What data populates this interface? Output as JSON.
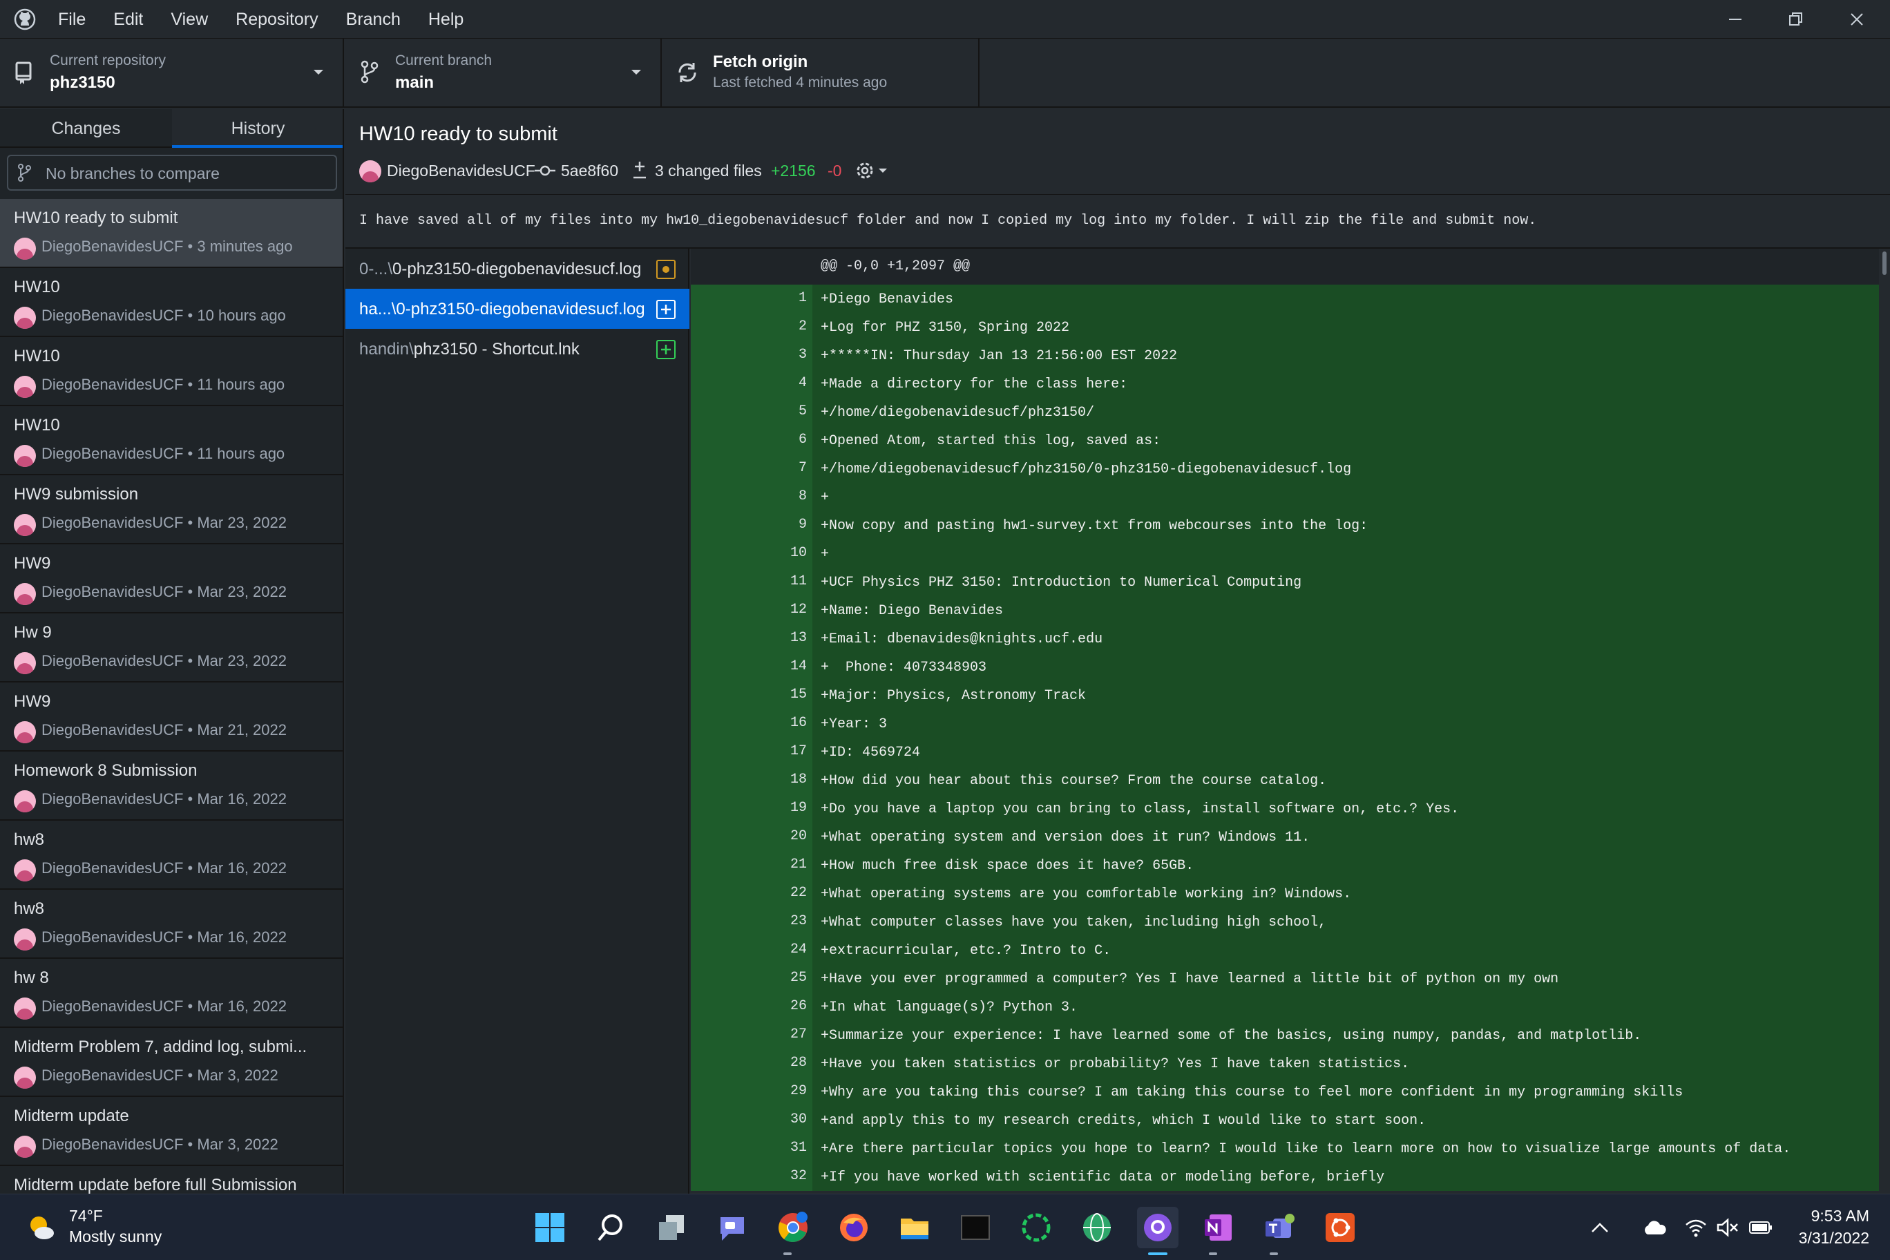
{
  "menu": [
    "File",
    "Edit",
    "View",
    "Repository",
    "Branch",
    "Help"
  ],
  "toolbar": {
    "repo_label": "Current repository",
    "repo_value": "phz3150",
    "branch_label": "Current branch",
    "branch_value": "main",
    "fetch_label": "Fetch origin",
    "fetch_sub": "Last fetched 4 minutes ago"
  },
  "tabs": {
    "changes": "Changes",
    "history": "History"
  },
  "compare_placeholder": "No branches to compare",
  "commits": [
    {
      "title": "HW10 ready to submit",
      "meta": "DiegoBenavidesUCF • 3 minutes ago"
    },
    {
      "title": "HW10",
      "meta": "DiegoBenavidesUCF • 10 hours ago"
    },
    {
      "title": "HW10",
      "meta": "DiegoBenavidesUCF • 11 hours ago"
    },
    {
      "title": "HW10",
      "meta": "DiegoBenavidesUCF • 11 hours ago"
    },
    {
      "title": "HW9 submission",
      "meta": "DiegoBenavidesUCF • Mar 23, 2022"
    },
    {
      "title": "HW9",
      "meta": "DiegoBenavidesUCF • Mar 23, 2022"
    },
    {
      "title": "Hw 9",
      "meta": "DiegoBenavidesUCF • Mar 23, 2022"
    },
    {
      "title": "HW9",
      "meta": "DiegoBenavidesUCF • Mar 21, 2022"
    },
    {
      "title": "Homework 8 Submission",
      "meta": "DiegoBenavidesUCF • Mar 16, 2022"
    },
    {
      "title": "hw8",
      "meta": "DiegoBenavidesUCF • Mar 16, 2022"
    },
    {
      "title": "hw8",
      "meta": "DiegoBenavidesUCF • Mar 16, 2022"
    },
    {
      "title": "hw 8",
      "meta": "DiegoBenavidesUCF • Mar 16, 2022"
    },
    {
      "title": "Midterm Problem 7, addind log, submi...",
      "meta": "DiegoBenavidesUCF • Mar 3, 2022"
    },
    {
      "title": "Midterm update",
      "meta": "DiegoBenavidesUCF • Mar 3, 2022"
    },
    {
      "title": "Midterm update before full Submission",
      "meta": ""
    }
  ],
  "commit_detail": {
    "title": "HW10 ready to submit",
    "author": "DiegoBenavidesUCF",
    "sha": "5ae8f60",
    "changed": "3 changed files",
    "additions": "+2156",
    "deletions": "-0",
    "message": "I have saved all of my files into my hw10_diegobenavidesucf folder and now I copied my log into my folder. I will zip the file and submit now."
  },
  "files": [
    {
      "dir": "0-...\\",
      "name": "0-phz3150-diegobenavidesucf.log",
      "status": "modified"
    },
    {
      "dir": "ha...\\",
      "name": "0-phz3150-diegobenavidesucf.log",
      "status": "added"
    },
    {
      "dir": "handin\\",
      "name": "phz3150 - Shortcut.lnk",
      "status": "added"
    }
  ],
  "diff": {
    "hunk": "@@ -0,0 +1,2097 @@",
    "lines": [
      "+Diego Benavides",
      "+Log for PHZ 3150, Spring 2022",
      "+*****IN: Thursday Jan 13 21:56:00 EST 2022",
      "+Made a directory for the class here:",
      "+/home/diegobenavidesucf/phz3150/",
      "+Opened Atom, started this log, saved as:",
      "+/home/diegobenavidesucf/phz3150/0-phz3150-diegobenavidesucf.log",
      "+",
      "+Now copy and pasting hw1-survey.txt from webcourses into the log:",
      "+",
      "+UCF Physics PHZ 3150: Introduction to Numerical Computing",
      "+Name: Diego Benavides",
      "+Email: dbenavides@knights.ucf.edu",
      "+  Phone: 4073348903",
      "+Major: Physics, Astronomy Track",
      "+Year: 3",
      "+ID: 4569724",
      "+How did you hear about this course? From the course catalog.",
      "+Do you have a laptop you can bring to class, install software on, etc.? Yes.",
      "+What operating system and version does it run? Windows 11.",
      "+How much free disk space does it have? 65GB.",
      "+What operating systems are you comfortable working in? Windows.",
      "+What computer classes have you taken, including high school,",
      "+extracurricular, etc.? Intro to C.",
      "+Have you ever programmed a computer? Yes I have learned a little bit of python on my own",
      "+In what language(s)? Python 3.",
      "+Summarize your experience: I have learned some of the basics, using numpy, pandas, and matplotlib.",
      "+Have you taken statistics or probability? Yes I have taken statistics.",
      "+Why are you taking this course? I am taking this course to feel more confident in my programming skills",
      "+and apply this to my research credits, which I would like to start soon.",
      "+Are there particular topics you hope to learn? I would like to learn more on how to visualize large amounts of data.",
      "+If you have worked with scientific data or modeling before, briefly"
    ]
  },
  "taskbar": {
    "temp": "74°F",
    "weather": "Mostly sunny",
    "time": "9:53 AM",
    "date": "3/31/2022"
  }
}
